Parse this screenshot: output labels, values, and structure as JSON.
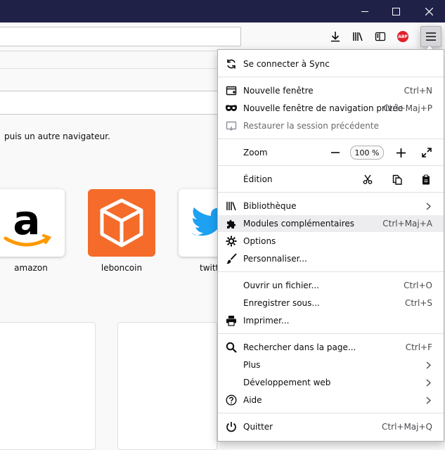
{
  "page": {
    "import_text": "puis un autre navigateur.",
    "tiles": [
      {
        "label": "amazon"
      },
      {
        "label": "leboncoin"
      },
      {
        "label": "twitt"
      }
    ]
  },
  "window": {
    "minimize_icon": "minimize-icon",
    "maximize_icon": "maximize-icon",
    "close_icon": "close-icon"
  },
  "toolbar": {
    "icons": [
      "download-icon",
      "library-icon",
      "sidebar-icon",
      "adblock-icon",
      "hamburger-menu-icon"
    ],
    "abp_badge": "ABP"
  },
  "menu": {
    "sync": {
      "label": "Se connecter à Sync"
    },
    "new_window": {
      "label": "Nouvelle fenêtre",
      "shortcut": "Ctrl+N"
    },
    "private_window": {
      "label": "Nouvelle fenêtre de navigation privée",
      "shortcut": "Ctrl+Maj+P"
    },
    "restore_session": {
      "label": "Restaurer la session précédente"
    },
    "zoom": {
      "label": "Zoom",
      "value": "100 %"
    },
    "edit": {
      "label": "Édition"
    },
    "library": {
      "label": "Bibliothèque"
    },
    "addons": {
      "label": "Modules complémentaires",
      "shortcut": "Ctrl+Maj+A"
    },
    "options": {
      "label": "Options"
    },
    "customize": {
      "label": "Personnaliser..."
    },
    "open_file": {
      "label": "Ouvrir un fichier...",
      "shortcut": "Ctrl+O"
    },
    "save_as": {
      "label": "Enregistrer sous...",
      "shortcut": "Ctrl+S"
    },
    "print": {
      "label": "Imprimer..."
    },
    "find": {
      "label": "Rechercher dans la page...",
      "shortcut": "Ctrl+F"
    },
    "more": {
      "label": "Plus"
    },
    "web_dev": {
      "label": "Développement web"
    },
    "help": {
      "label": "Aide"
    },
    "quit": {
      "label": "Quitter",
      "shortcut": "Ctrl+Maj+Q"
    }
  },
  "colors": {
    "titlebar": "#1f2147",
    "hover": "#ededf0",
    "leboncoin": "#f56b2a",
    "twitter": "#1da1f2",
    "amazon_smile": "#ff9900"
  }
}
